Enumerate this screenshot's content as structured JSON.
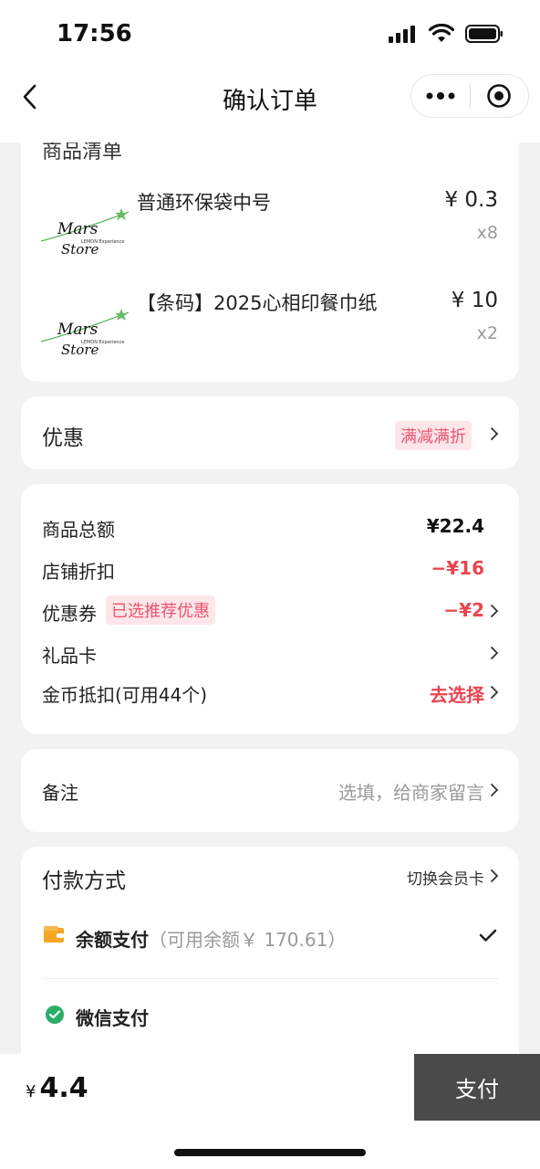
{
  "status": {
    "time": "17:56"
  },
  "nav": {
    "title": "确认订单"
  },
  "goods": {
    "section_title": "商品清单",
    "items": [
      {
        "name": "普通环保袋中号",
        "price": "¥ 0.3",
        "qty": "x8",
        "logo": "Mars Store"
      },
      {
        "name": "【条码】2025心相印餐巾纸",
        "price": "¥ 10",
        "qty": "x2",
        "logo": "Mars Store"
      }
    ],
    "logo_text_main": "Mars",
    "logo_text_sub": "Store",
    "logo_text_small": "LEMON Experience"
  },
  "discount": {
    "label": "优惠",
    "tag": "满减满折"
  },
  "summary": {
    "goods_total_label": "商品总额",
    "goods_total_value": "¥22.4",
    "shop_discount_label": "店铺折扣",
    "shop_discount_value": "−¥16",
    "coupon_label": "优惠券",
    "coupon_tag": "已选推荐优惠",
    "coupon_value": "−¥2",
    "giftcard_label": "礼品卡",
    "coins_label": "金币抵扣(可用44个)",
    "coins_value": "去选择"
  },
  "remark": {
    "label": "备注",
    "placeholder": "选填，给商家留言"
  },
  "payment": {
    "title": "付款方式",
    "switch_label": "切换会员卡",
    "balance_label": "余额支付",
    "balance_sub": "（可用余额￥ 170.61）",
    "wechat_label": "微信支付"
  },
  "footer": {
    "currency": "¥",
    "total": "4.4",
    "pay_label": "支付"
  },
  "colors": {
    "accent_red": "#e8454f",
    "tag_pink": "#fde6ea",
    "pay_button": "#4a4a4a",
    "wallet_orange": "#f5a623",
    "wechat_green": "#2aae67"
  }
}
